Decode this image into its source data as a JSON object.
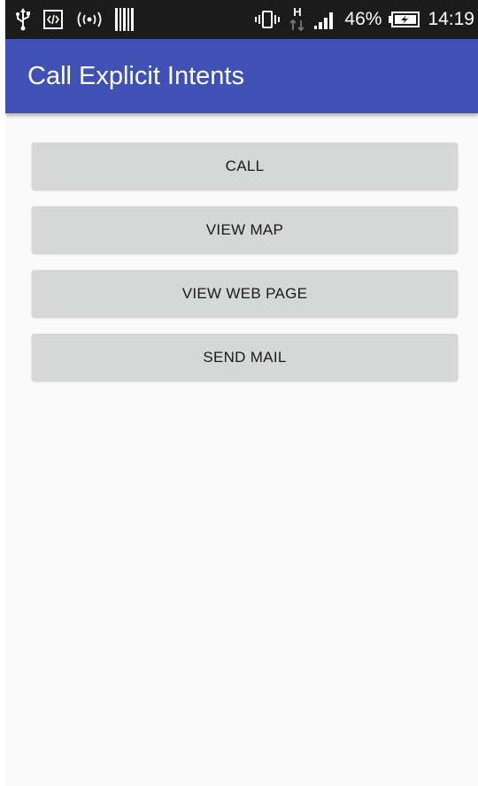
{
  "status_bar": {
    "battery_percent": "46%",
    "time": "14:19",
    "network_type": "H",
    "icons": [
      "usb-icon",
      "developer-mode-icon",
      "wireless-broadcast-icon",
      "barcode-icon",
      "vibrate-icon",
      "network-activity-icon",
      "signal-icon",
      "battery-charging-icon"
    ]
  },
  "app_bar": {
    "title": "Call Explicit Intents",
    "color": "#3f51b5"
  },
  "buttons": [
    {
      "label": "CALL"
    },
    {
      "label": "VIEW MAP"
    },
    {
      "label": "VIEW WEB PAGE"
    },
    {
      "label": "SEND MAIL"
    }
  ]
}
